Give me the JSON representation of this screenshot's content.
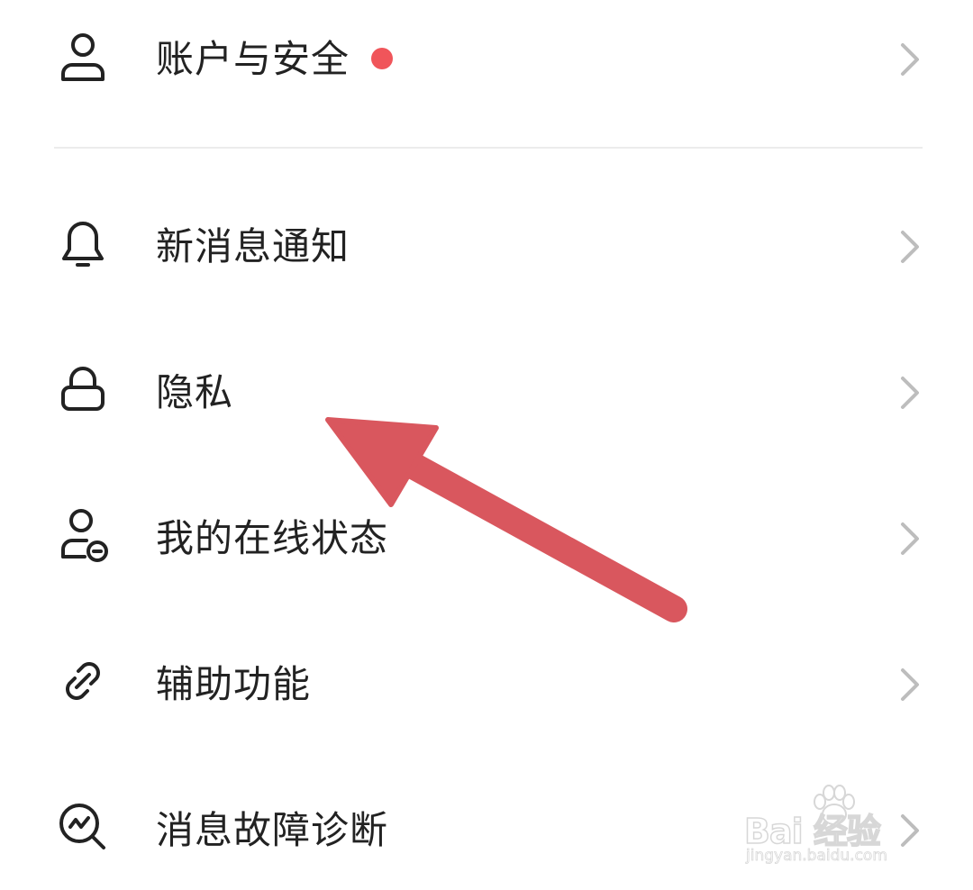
{
  "settings": {
    "items": [
      {
        "label": "账户与安全",
        "icon": "user-icon",
        "has_badge": true
      },
      {
        "label": "新消息通知",
        "icon": "bell-icon",
        "has_badge": false
      },
      {
        "label": "隐私",
        "icon": "lock-icon",
        "has_badge": false
      },
      {
        "label": "我的在线状态",
        "icon": "online-status-icon",
        "has_badge": false
      },
      {
        "label": "辅助功能",
        "icon": "link-icon",
        "has_badge": false
      },
      {
        "label": "消息故障诊断",
        "icon": "diagnosis-icon",
        "has_badge": false
      }
    ]
  },
  "colors": {
    "badge": "#f0555a",
    "arrow": "#d9575e",
    "icon": "#222222",
    "chevron": "#bdbdbd",
    "divider": "#ececec"
  },
  "watermark": {
    "brand": "Bai 经验",
    "brand_du": "du",
    "url": "jingyan.baidu.com"
  }
}
